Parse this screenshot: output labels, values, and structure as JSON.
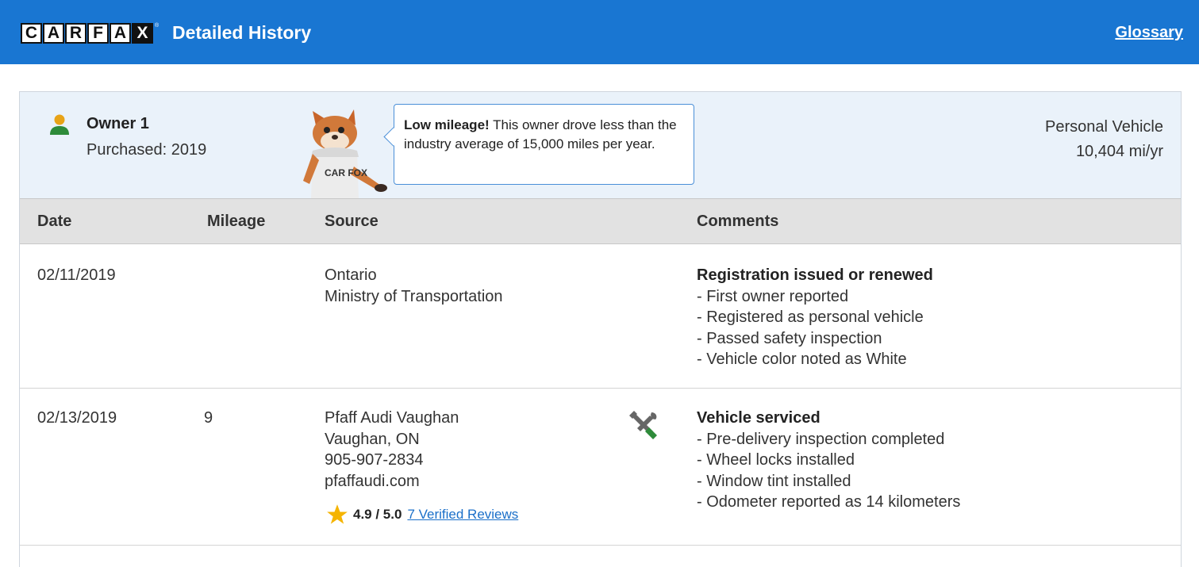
{
  "header": {
    "logo_letters": [
      "C",
      "A",
      "R",
      "F",
      "A",
      "X"
    ],
    "logo_reg": "®",
    "title": "Detailed History",
    "glossary_link": "Glossary",
    "bar_color": "#1976d2"
  },
  "owner": {
    "name": "Owner 1",
    "purchased": "Purchased: 2019",
    "icon": "person-icon",
    "mascot_shirt": "CAR FOX",
    "tip_bold": "Low mileage!",
    "tip_text": " This owner drove less than the industry average of 15,000 miles per year.",
    "usage_type": "Personal Vehicle",
    "usage_rate": "10,404 mi/yr"
  },
  "table": {
    "headers": [
      "Date",
      "Mileage",
      "Source",
      "Comments"
    ],
    "rows": [
      {
        "date": "02/11/2019",
        "mileage": "",
        "source_lines": [
          "Ontario",
          "Ministry of Transportation"
        ],
        "comment_title": "Registration issued or renewed",
        "comment_items": [
          "- First owner reported",
          "- Registered as personal vehicle",
          "- Passed safety inspection",
          "- Vehicle color noted as White"
        ]
      },
      {
        "date": "02/13/2019",
        "mileage": "9",
        "source_lines": [
          "Pfaff Audi Vaughan",
          "Vaughan, ON",
          "905-907-2834",
          "pfaffaudi.com"
        ],
        "icon": "wrench-screwdriver-icon",
        "rating_score": "4.9 / 5.0",
        "rating_reviews": "7 Verified Reviews",
        "comment_title": "Vehicle serviced",
        "comment_items": [
          "- Pre-delivery inspection completed",
          "- Wheel locks installed",
          "- Window tint installed",
          "- Odometer reported as 14 kilometers"
        ]
      }
    ]
  }
}
